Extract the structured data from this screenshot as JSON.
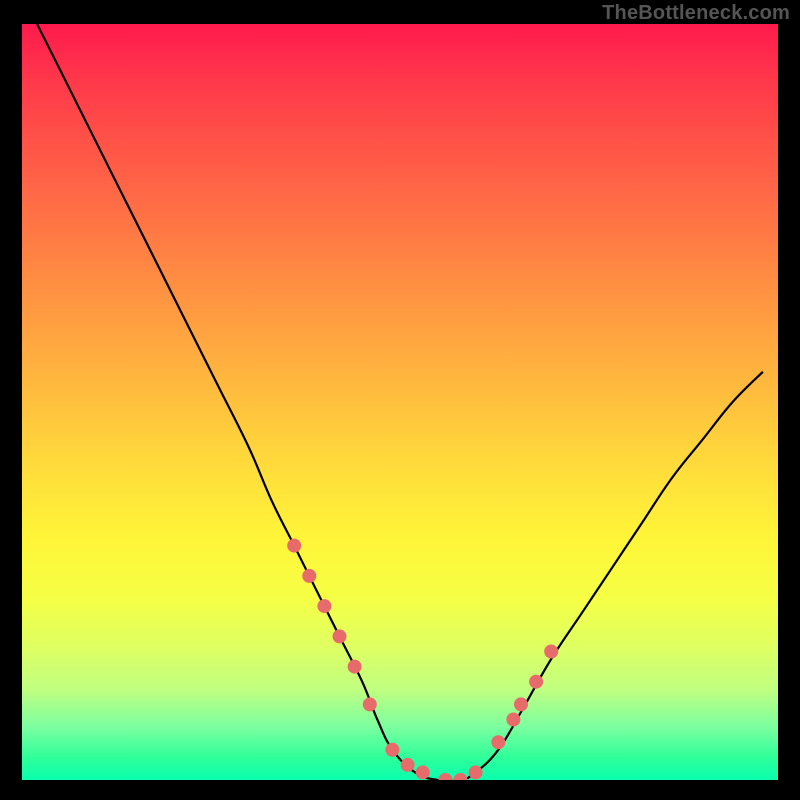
{
  "watermark": "TheBottleneck.com",
  "chart_data": {
    "type": "line",
    "title": "",
    "xlabel": "",
    "ylabel": "",
    "xlim": [
      0,
      100
    ],
    "ylim": [
      0,
      100
    ],
    "grid": false,
    "legend": false,
    "background_gradient": {
      "top": "#ff1a4d",
      "bottom": "#0affae",
      "direction": "vertical"
    },
    "series": [
      {
        "name": "bottleneck-curve",
        "x": [
          2,
          6,
          10,
          14,
          18,
          22,
          26,
          30,
          33,
          36,
          39,
          42,
          45,
          47,
          49,
          52,
          55,
          58,
          60,
          63,
          66,
          70,
          74,
          78,
          82,
          86,
          90,
          94,
          98
        ],
        "y": [
          100,
          92,
          84,
          76,
          68,
          60,
          52,
          44,
          37,
          31,
          25,
          19,
          13,
          8,
          4,
          1,
          0,
          0,
          1,
          4,
          9,
          16,
          22,
          28,
          34,
          40,
          45,
          50,
          54
        ],
        "line_color": "#000000"
      }
    ],
    "markers": {
      "name": "highlighted-points",
      "color": "#e86b6b",
      "radius_px": 7,
      "points_x": [
        36,
        38,
        40,
        42,
        44,
        46,
        49,
        51,
        53,
        56,
        58,
        60,
        63,
        65,
        66,
        68,
        70
      ],
      "points_y": [
        31,
        27,
        23,
        19,
        15,
        10,
        4,
        2,
        1,
        0,
        0,
        1,
        5,
        8,
        10,
        13,
        17
      ]
    }
  }
}
